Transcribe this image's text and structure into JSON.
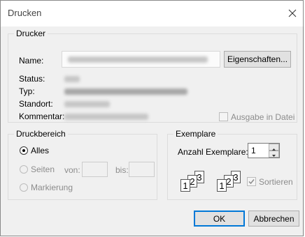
{
  "window": {
    "title": "Drucken"
  },
  "printer": {
    "group_label": "Drucker",
    "name_label": "Name:",
    "status_label": "Status:",
    "type_label": "Typ:",
    "location_label": "Standort:",
    "comment_label": "Kommentar:",
    "properties_button": "Eigenschaften...",
    "print_to_file_label": "Ausgabe in Datei",
    "print_to_file_checked": false
  },
  "range": {
    "group_label": "Druckbereich",
    "all_label": "Alles",
    "pages_label": "Seiten",
    "from_label": "von:",
    "to_label": "bis:",
    "selection_label": "Markierung",
    "selected": "all"
  },
  "copies": {
    "group_label": "Exemplare",
    "count_label": "Anzahl Exemplare:",
    "count_value": "1",
    "collate_label": "Sortieren",
    "collate_checked": true,
    "page_numbers": [
      "1",
      "2",
      "3"
    ]
  },
  "buttons": {
    "ok": "OK",
    "cancel": "Abbrechen"
  },
  "icons": {
    "close": "close-icon",
    "spin_up": "spin-up-icon",
    "spin_down": "spin-down-icon",
    "check": "checkmark-icon"
  }
}
